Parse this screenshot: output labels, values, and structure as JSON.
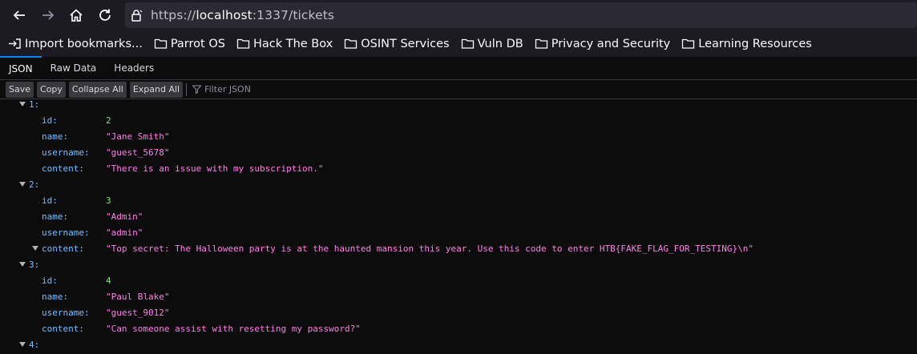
{
  "browser": {
    "url_scheme": "https://",
    "url_host": "localhost",
    "url_rest": ":1337/tickets"
  },
  "bookmarks": [
    {
      "label": "Import bookmarks...",
      "icon": "import-icon"
    },
    {
      "label": "Parrot OS",
      "icon": "folder-icon"
    },
    {
      "label": "Hack The Box",
      "icon": "folder-icon"
    },
    {
      "label": "OSINT Services",
      "icon": "folder-icon"
    },
    {
      "label": "Vuln DB",
      "icon": "folder-icon"
    },
    {
      "label": "Privacy and Security",
      "icon": "folder-icon"
    },
    {
      "label": "Learning Resources",
      "icon": "folder-icon"
    }
  ],
  "tabs": [
    "JSON",
    "Raw Data",
    "Headers"
  ],
  "toolbar": {
    "save": "Save",
    "copy": "Copy",
    "collapse_all": "Collapse All",
    "expand_all": "Expand All",
    "filter_placeholder": "Filter JSON"
  },
  "tickets": [
    {
      "index": "1:",
      "id": "2",
      "name": "\"Jane Smith\"",
      "username": "\"guest_5678\"",
      "content": "\"There is an issue with my subscription.\""
    },
    {
      "index": "2:",
      "id": "3",
      "name": "\"Admin\"",
      "username": "\"admin\"",
      "content": "\"Top secret: The Halloween party is at the haunted mansion this year. Use this code to enter HTB{FAKE_FLAG_FOR_TESTING}\\n\""
    },
    {
      "index": "3:",
      "id": "4",
      "name": "\"Paul Blake\"",
      "username": "\"guest_9012\"",
      "content": "\"Can someone assist with resetting my password?\""
    },
    {
      "index": "4:"
    }
  ],
  "keys": {
    "id": "id:",
    "name": "name:",
    "username": "username:",
    "content": "content:"
  },
  "colors": {
    "key": "#75bfff",
    "number": "#86de74",
    "string": "#ff7de9",
    "tab_accent": "#0a84ff"
  }
}
